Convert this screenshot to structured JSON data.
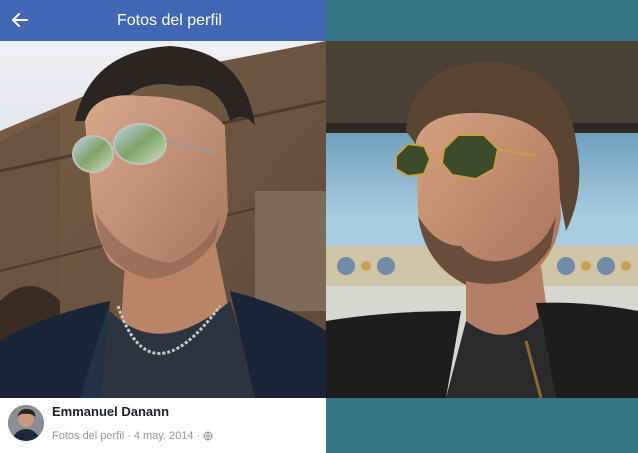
{
  "header": {
    "title": "Fotos del perfil",
    "back_icon": "arrow-left-icon",
    "background": "#4267b2"
  },
  "post": {
    "author": "Emmanuel Danann",
    "album": "Fotos del perfil",
    "separator": "·",
    "date": "4 may. 2014",
    "privacy_icon": "globe-icon"
  },
  "colors": {
    "right_background": "#347683"
  }
}
